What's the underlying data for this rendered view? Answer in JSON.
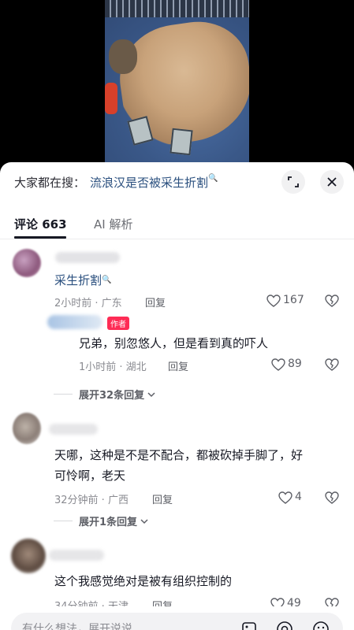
{
  "search": {
    "prefix": "大家都在搜：",
    "query": "流浪汉是否被采生折割",
    "magnifier": "🔍"
  },
  "tabs": [
    {
      "label": "评论 663",
      "active": true
    },
    {
      "label": "AI 解析",
      "active": false
    }
  ],
  "comments": [
    {
      "text": "采生折割",
      "is_link": true,
      "meta": "2小时前 · 广东",
      "reply_label": "回复",
      "likes": "167"
    },
    {
      "badge": "作者",
      "text": "兄弟，别忽悠人，但是看到真的吓人",
      "meta": "1小时前 · 湖北",
      "reply_label": "回复",
      "likes": "89",
      "is_reply": true
    },
    {
      "text_line1": "天哪，这种是不是不配合，都被砍掉手脚了，好",
      "text_line2": "可怜啊，老天",
      "meta": "32分钟前 · 广西",
      "reply_label": "回复",
      "likes": "4"
    },
    {
      "text": "这个我感觉绝对是被有组织控制的",
      "meta": "34分钟前 · 天津",
      "reply_label": "回复",
      "likes": "49"
    }
  ],
  "expand_replies": [
    "展开32条回复",
    "展开1条回复"
  ],
  "input": {
    "placeholder": "有什么想法，展开说说"
  },
  "icons": {
    "expand": "expand-icon",
    "close": "close-icon",
    "like": "heart-icon",
    "dislike": "broken-heart-icon",
    "image": "image-icon",
    "mention": "at-icon",
    "emoji": "emoji-icon"
  },
  "colors": {
    "link": "#2a4f7e",
    "author_badge": "#fe2c55"
  }
}
